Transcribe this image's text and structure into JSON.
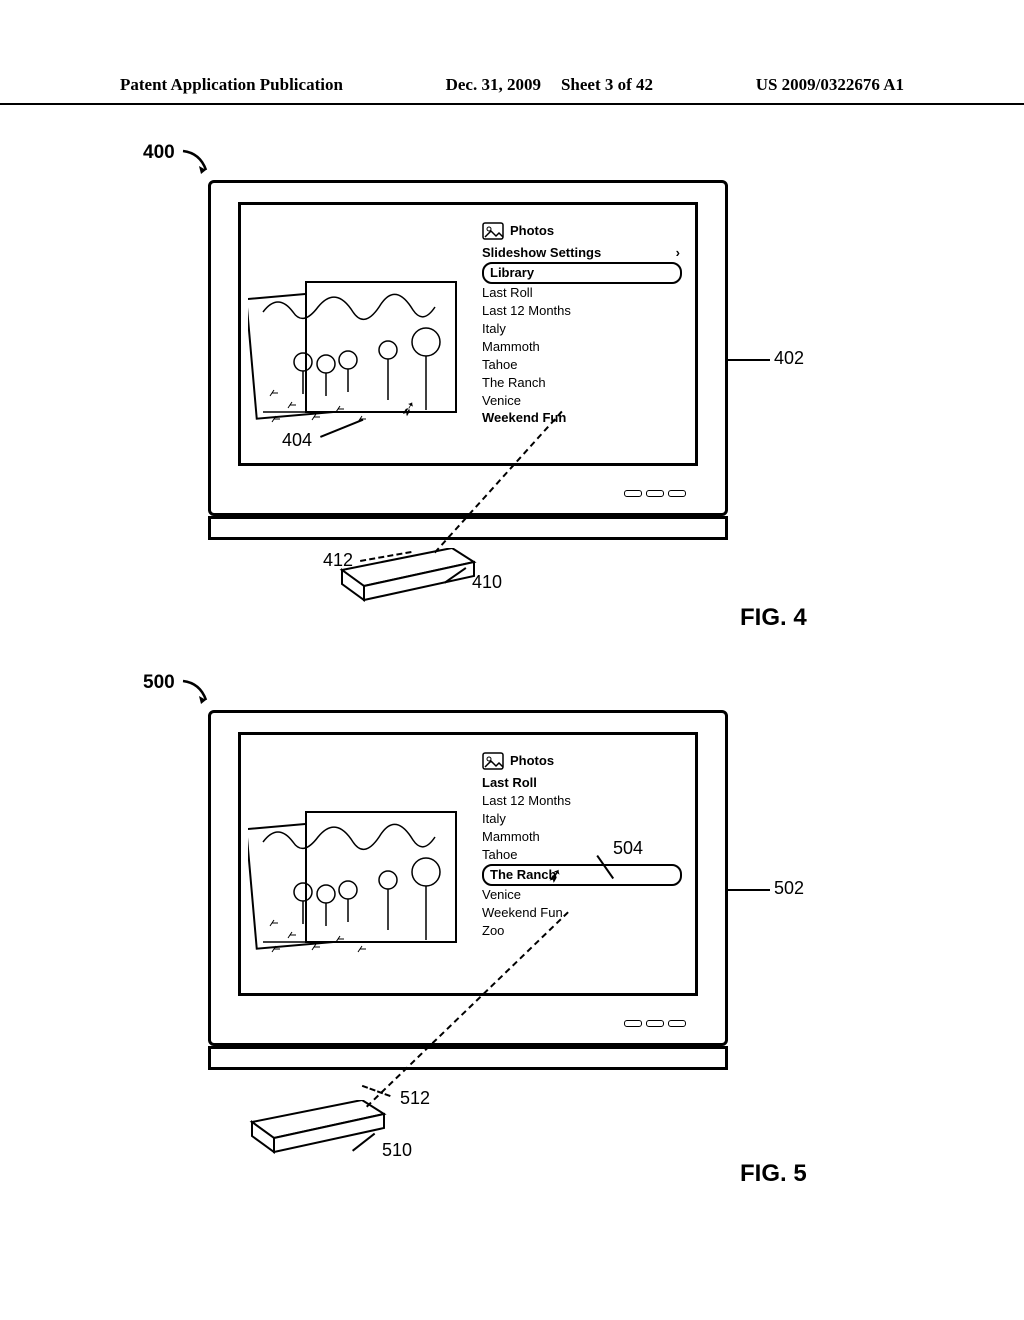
{
  "header": {
    "left": "Patent Application Publication",
    "date": "Dec. 31, 2009",
    "sheet": "Sheet 3 of 42",
    "pubno": "US 2009/0322676 A1"
  },
  "fig4": {
    "sys_ref": "400",
    "disp_ref": "402",
    "img_ref": "404",
    "remote_ref": "410",
    "line_ref": "412",
    "title_label": "Photos",
    "settings_label": "Slideshow Settings",
    "selected_item": "Library",
    "items": [
      "Last Roll",
      "Last 12 Months",
      "Italy",
      "Mammoth",
      "Tahoe",
      "The Ranch",
      "Venice",
      "Weekend Fun"
    ],
    "fig_label": "FIG. 4"
  },
  "fig5": {
    "sys_ref": "500",
    "disp_ref": "502",
    "sel_ref": "504",
    "remote_ref": "510",
    "line_ref": "512",
    "title_label": "Photos",
    "pre_items": [
      "Last Roll",
      "Last 12 Months",
      "Italy",
      "Mammoth",
      "Tahoe"
    ],
    "selected_item": "The Ranch",
    "post_items": [
      "Venice",
      "Weekend Fun",
      "Zoo"
    ],
    "fig_label": "FIG. 5"
  }
}
